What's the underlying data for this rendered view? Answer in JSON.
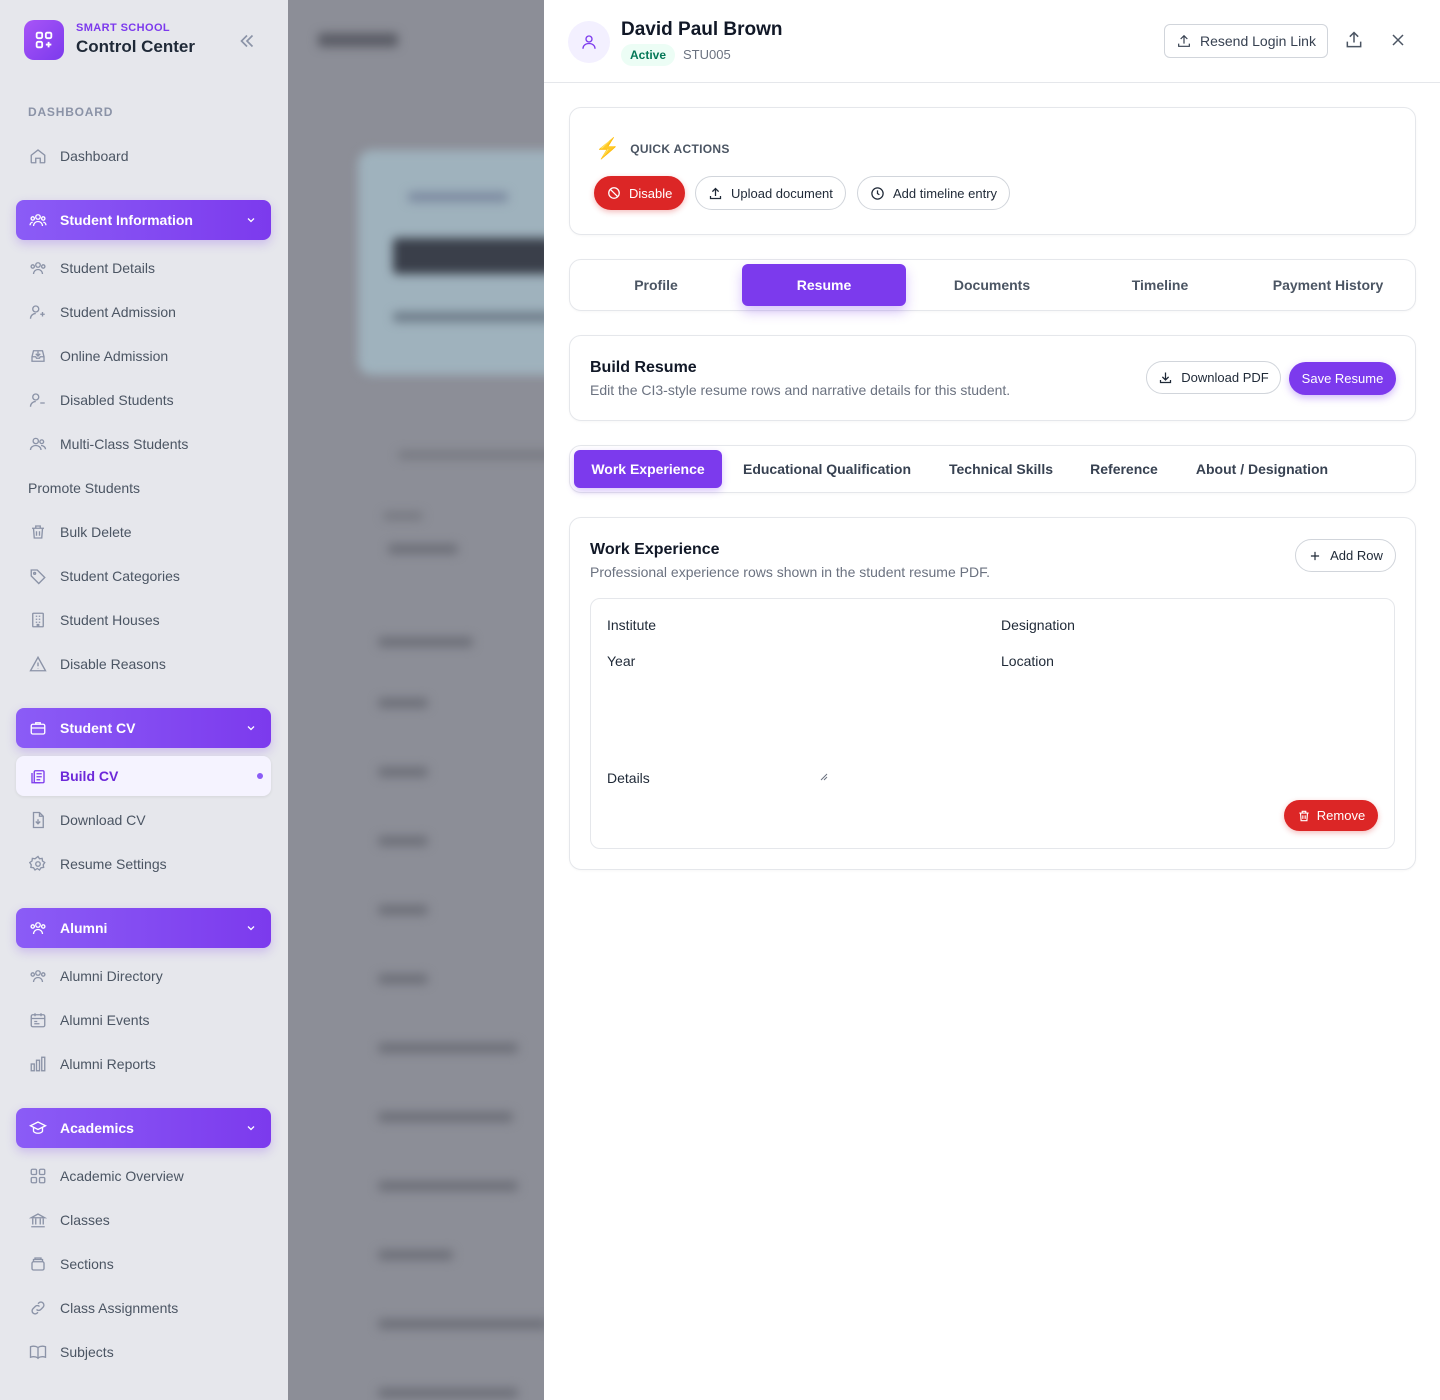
{
  "brand": {
    "subtitle": "SMART SCHOOL",
    "title": "Control Center"
  },
  "sidebar": {
    "section_label": "DASHBOARD",
    "dashboard": "Dashboard",
    "groups": {
      "student_information": "Student Information",
      "student_cv": "Student CV",
      "alumni": "Alumni",
      "academics": "Academics"
    },
    "student_information_items": [
      "Student Details",
      "Student Admission",
      "Online Admission",
      "Disabled Students",
      "Multi-Class Students",
      "Promote Students",
      "Bulk Delete",
      "Student Categories",
      "Student Houses",
      "Disable Reasons"
    ],
    "student_cv_items": [
      "Build CV",
      "Download CV",
      "Resume Settings"
    ],
    "alumni_items": [
      "Alumni Directory",
      "Alumni Events",
      "Alumni Reports"
    ],
    "academics_items": [
      "Academic Overview",
      "Classes",
      "Sections",
      "Class Assignments",
      "Subjects"
    ]
  },
  "student": {
    "name": "David Paul Brown",
    "status": "Active",
    "code": "STU005"
  },
  "header": {
    "resend_label": "Resend Login Link"
  },
  "quick_actions": {
    "title": "QUICK ACTIONS",
    "disable": "Disable",
    "upload": "Upload document",
    "timeline": "Add timeline entry"
  },
  "tabs": [
    "Profile",
    "Resume",
    "Documents",
    "Timeline",
    "Payment History"
  ],
  "build_resume": {
    "title": "Build Resume",
    "description": "Edit the CI3-style resume rows and narrative details for this student.",
    "download_label": "Download PDF",
    "save_label": "Save Resume"
  },
  "subtabs": [
    "Work Experience",
    "Educational Qualification",
    "Technical Skills",
    "Reference",
    "About / Designation"
  ],
  "work_experience": {
    "title": "Work Experience",
    "description": "Professional experience rows shown in the student resume PDF.",
    "add_label": "Add Row",
    "fields": {
      "institute": "Institute",
      "designation": "Designation",
      "year": "Year",
      "location": "Location",
      "details": "Details"
    },
    "remove_label": "Remove"
  },
  "colors": {
    "accent": "#7c3aed",
    "danger": "#dc2626",
    "success": "#047857"
  }
}
